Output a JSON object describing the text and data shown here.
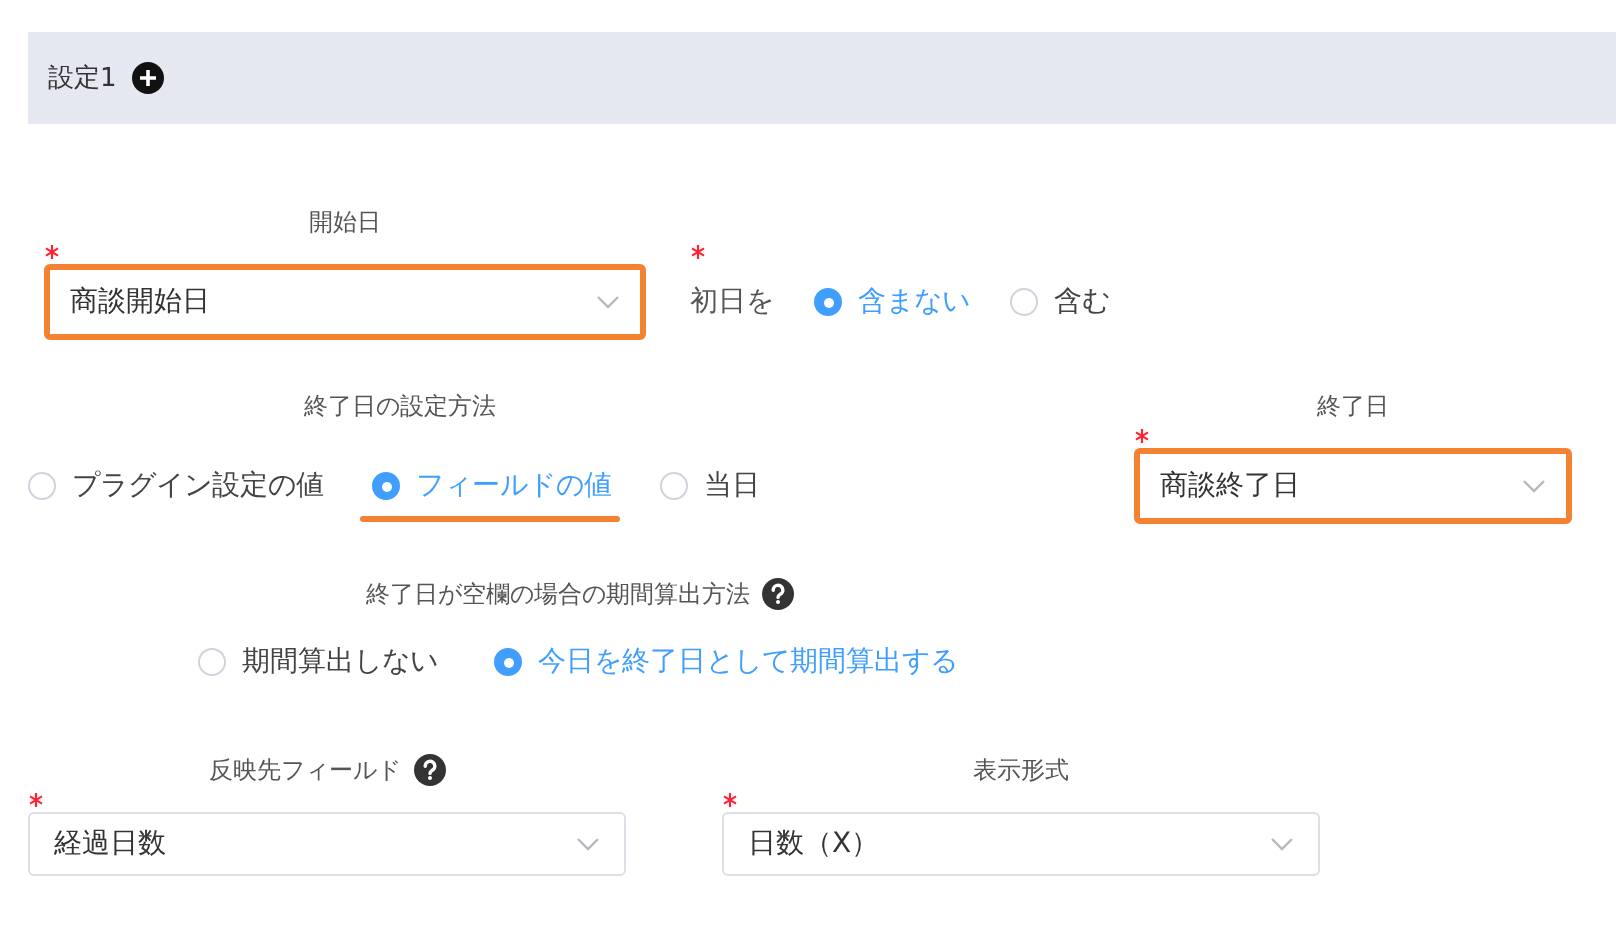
{
  "section": {
    "title": "設定1"
  },
  "start_date": {
    "label": "開始日",
    "required": true,
    "value": "商談開始日",
    "highlighted": true
  },
  "first_day": {
    "label": "初日を",
    "required": true,
    "options": [
      {
        "label": "含まない",
        "selected": true,
        "highlighted": false
      },
      {
        "label": "含む",
        "selected": false,
        "highlighted": false
      }
    ]
  },
  "end_method": {
    "label": "終了日の設定方法",
    "options": [
      {
        "label": "プラグイン設定の値",
        "selected": false,
        "highlighted": false
      },
      {
        "label": "フィールドの値",
        "selected": true,
        "highlighted": true
      },
      {
        "label": "当日",
        "selected": false,
        "highlighted": false
      }
    ]
  },
  "end_date": {
    "label": "終了日",
    "required": true,
    "value": "商談終了日",
    "highlighted": true
  },
  "blank_end": {
    "label": "終了日が空欄の場合の期間算出方法",
    "help": true,
    "options": [
      {
        "label": "期間算出しない",
        "selected": false,
        "highlighted": false
      },
      {
        "label": "今日を終了日として期間算出する",
        "selected": true,
        "highlighted": false
      }
    ]
  },
  "target_field": {
    "label": "反映先フィールド",
    "help": true,
    "required": true,
    "value": "経過日数",
    "highlighted": false
  },
  "display_format": {
    "label": "表示形式",
    "required": true,
    "value": "日数（X）",
    "highlighted": false
  }
}
